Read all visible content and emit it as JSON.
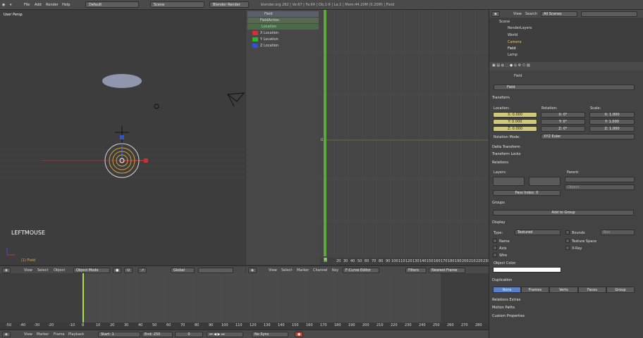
{
  "top": {
    "menus": [
      "File",
      "Add",
      "Render",
      "Help"
    ],
    "layout": "Default",
    "scene": "Scene",
    "engine": "Blender Render",
    "info": "blender.org 262 | Ve:67 | Fa:64 | Ob:1-6 | La:1 | Mem:44.20M (0.20M) | Field"
  },
  "viewport": {
    "label": "User Persp",
    "key": "LEFTMOUSE",
    "obj": "(1) Field",
    "menus": [
      "View",
      "Select",
      "Object"
    ],
    "mode": "Object Mode",
    "pivot": "Global"
  },
  "graph": {
    "channels": [
      "Field",
      "FieldAction",
      "Location",
      "X Location",
      "Y Location",
      "Z Location"
    ],
    "xticks": [
      "20",
      "30",
      "40",
      "50",
      "60",
      "70",
      "80",
      "90",
      "100",
      "110",
      "120",
      "130",
      "140",
      "150",
      "160",
      "170",
      "180",
      "190",
      "200",
      "210",
      "220",
      "230",
      "240"
    ],
    "frame": "0",
    "yzero": "0",
    "menus": [
      "View",
      "Select",
      "Marker",
      "Channel",
      "Key"
    ],
    "editor": "F-Curve Editor",
    "filters": "Filters",
    "interp": "Nearest Frame"
  },
  "timeline": {
    "ticks": [
      "-50",
      "-40",
      "-30",
      "-20",
      "-10",
      "0",
      "10",
      "20",
      "30",
      "40",
      "50",
      "60",
      "70",
      "80",
      "90",
      "100",
      "110",
      "120",
      "130",
      "140",
      "150",
      "160",
      "170",
      "180",
      "190",
      "200",
      "210",
      "220",
      "230",
      "240",
      "250",
      "260",
      "270",
      "280"
    ],
    "menus": [
      "View",
      "Marker",
      "Frame",
      "Playback"
    ],
    "start": "Start: 1",
    "end": "End: 250",
    "cur": "0",
    "sync": "No Sync"
  },
  "outliner": {
    "menus": [
      "View",
      "Search"
    ],
    "scope": "All Scenes",
    "items": [
      "Scene",
      "RenderLayers",
      "World",
      "Camera",
      "Field",
      "Lamp"
    ]
  },
  "props": {
    "name": "Field",
    "transform": "Transform",
    "location": "Location:",
    "rotation": "Rotation:",
    "scale": "Scale:",
    "loc": [
      "X: 0.000",
      "Y: 0.000",
      "Z: 0.000"
    ],
    "rot": [
      "X: 0°",
      "Y: 0°",
      "Z: 0°"
    ],
    "scl": [
      "X: 1.000",
      "Y: 1.000",
      "Z: 1.000"
    ],
    "rotmode_label": "Rotation Mode:",
    "rotmode": "XYZ Euler",
    "delta": "Delta Transform",
    "locks": "Transform Locks",
    "relations": "Relations",
    "layers": "Layers:",
    "parent": "Parent:",
    "parent_type": "Object",
    "pass": "Pass Index: 0",
    "groups": "Groups",
    "addgroup": "Add to Group",
    "display": "Display",
    "type_label": "Type:",
    "type": "Textured",
    "bounds": "Bounds",
    "box": "Box",
    "name_cb": "Name",
    "axis": "Axis",
    "wire": "Wire",
    "texspace": "Texture Space",
    "xray": "X-Ray",
    "objcolor": "Object Color:",
    "dup": "Duplication",
    "duptabs": [
      "None",
      "Frames",
      "Verts",
      "Faces",
      "Group"
    ],
    "relextras": "Relations Extras",
    "motion": "Motion Paths",
    "custom": "Custom Properties"
  }
}
